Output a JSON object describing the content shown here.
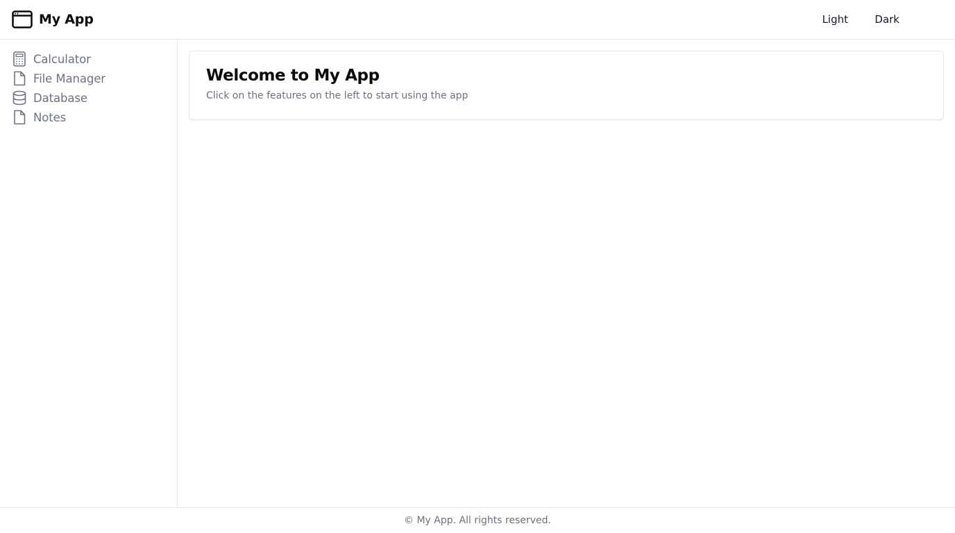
{
  "app": {
    "title": "My App"
  },
  "header": {
    "theme_options": [
      {
        "label": "Light"
      },
      {
        "label": "Dark"
      }
    ]
  },
  "sidebar": {
    "items": [
      {
        "label": "Calculator",
        "icon": "calculator-icon"
      },
      {
        "label": "File Manager",
        "icon": "file-icon"
      },
      {
        "label": "Database",
        "icon": "database-icon"
      },
      {
        "label": "Notes",
        "icon": "file-icon"
      }
    ]
  },
  "main": {
    "welcome_title": "Welcome to My App",
    "welcome_subtitle": "Click on the features on the left to start using the app"
  },
  "footer": {
    "text": "© My App. All rights reserved."
  },
  "colors": {
    "border": "#e5e7eb",
    "muted_text": "#6b7280",
    "primary_text": "#0b0b0b"
  }
}
